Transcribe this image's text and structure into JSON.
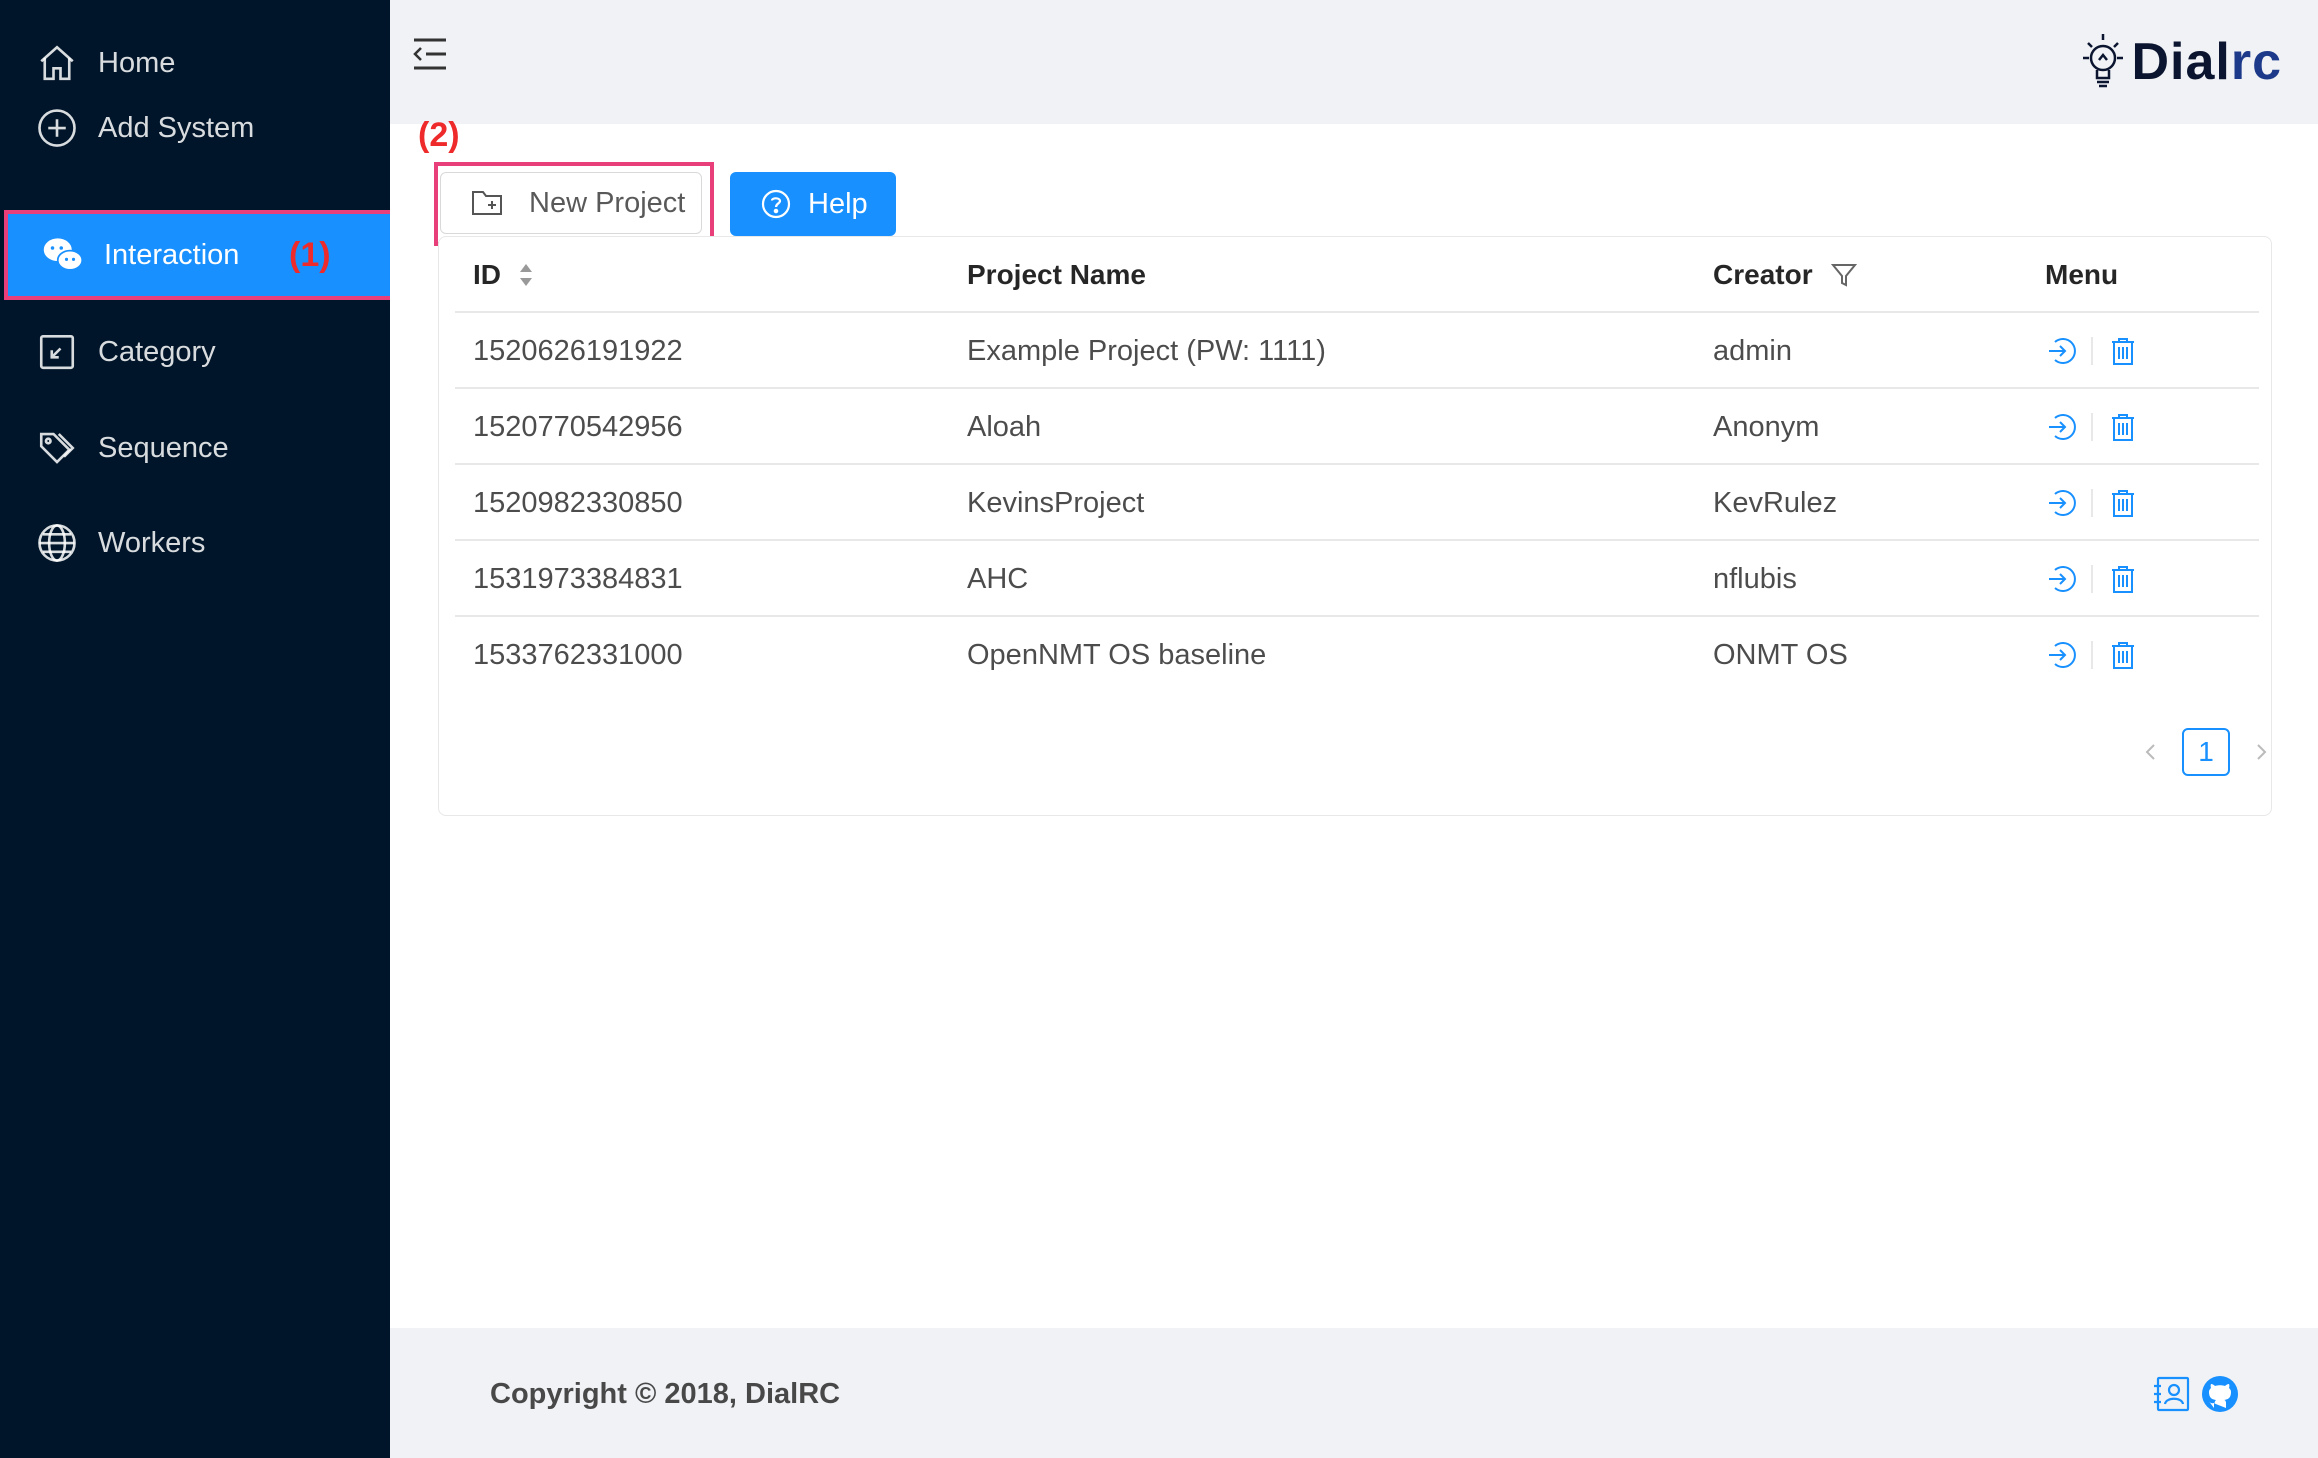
{
  "sidebar": {
    "items": [
      {
        "label": "Home",
        "icon": "home-icon"
      },
      {
        "label": "Add System",
        "icon": "plus-circle-icon"
      },
      {
        "label": "Interaction",
        "icon": "wechat-icon",
        "active": true
      },
      {
        "label": "Category",
        "icon": "export-icon"
      },
      {
        "label": "Sequence",
        "icon": "tags-icon"
      },
      {
        "label": "Workers",
        "icon": "global-icon"
      }
    ],
    "annotation": "(1)"
  },
  "header": {
    "logo_main": "Dial",
    "logo_accent": "rc"
  },
  "toolbar": {
    "annotation": "(2)",
    "new_project_label": "New Project",
    "help_label": "Help"
  },
  "table": {
    "columns": [
      "ID",
      "Project Name",
      "Creator",
      "Menu"
    ],
    "rows": [
      {
        "id": "1520626191922",
        "name": "Example Project (PW: 1111)",
        "creator": "admin"
      },
      {
        "id": "1520770542956",
        "name": "Aloah",
        "creator": "Anonym"
      },
      {
        "id": "1520982330850",
        "name": "KevinsProject",
        "creator": "KevRulez"
      },
      {
        "id": "1531973384831",
        "name": "AHC",
        "creator": "nflubis"
      },
      {
        "id": "1533762331000",
        "name": "OpenNMT OS baseline",
        "creator": "ONMT OS"
      }
    ]
  },
  "pagination": {
    "current": "1"
  },
  "footer": {
    "copyright": "Copyright © 2018, DialRC"
  },
  "colors": {
    "sidebar_bg": "#001529",
    "accent": "#1890ff",
    "annotation_red": "#ee2a2a",
    "annotation_box": "#e83f7a"
  }
}
